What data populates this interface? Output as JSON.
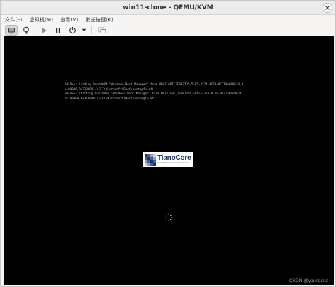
{
  "window": {
    "title": "win11-clone - QEMU/KVM"
  },
  "menubar": {
    "items": [
      {
        "label": "文件(F)"
      },
      {
        "label": "虚拟机(M)"
      },
      {
        "label": "查看(V)"
      },
      {
        "label": "发送按键(K)"
      }
    ]
  },
  "toolbar": {
    "buttons": [
      {
        "icon": "monitor-icon",
        "active": true
      },
      {
        "icon": "lightbulb-icon",
        "active": false
      },
      {
        "icon": "play-icon",
        "active": false
      },
      {
        "icon": "pause-icon",
        "active": false
      },
      {
        "icon": "power-icon",
        "active": false
      },
      {
        "icon": "dropdown-arrow-icon",
        "active": false
      },
      {
        "icon": "fullscreen-icon",
        "active": false
      }
    ]
  },
  "console": {
    "boot_lines": [
      "BdsDxe: loading Boot0004 \"Windows Boot Manager\" from HD(2,GPT,2F0B77D5-5FE5-4224-AC79-9C71A66B9624,0",
      "x109000,0x31B000)/\\EFI\\Microsoft\\Boot\\bootmgfw.efi",
      "BdsDxe: starting Boot0004 \"Windows Boot Manager\" from HD(2,GPT,2F0B77D5-5FE5-4224-AC79-9C71A66B9624,",
      "0x109000,0x31B000)/\\EFI\\Microsoft\\Boot\\bootmgfw.efi"
    ],
    "logo_name": "TianoCore",
    "logo_tagline": "Open Platform Firmware Development"
  },
  "watermark": "CSDN @youngonz",
  "colors": {
    "screen_bg": "#000000",
    "console_text": "#bdbdbd",
    "logo_navy": "#1d2f63"
  }
}
